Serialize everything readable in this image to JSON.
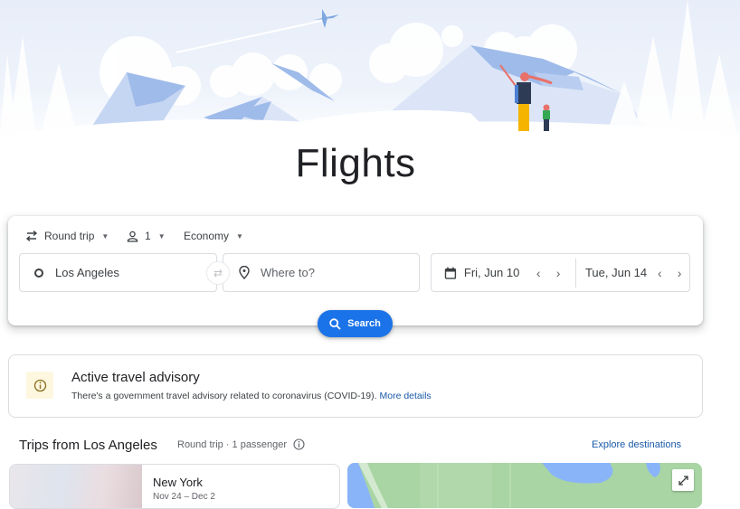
{
  "page": {
    "title": "Flights"
  },
  "search": {
    "trip_type": "Round trip",
    "passengers": "1",
    "cabin_class": "Economy",
    "origin": "Los Angeles",
    "destination_placeholder": "Where to?",
    "depart_date": "Fri, Jun 10",
    "return_date": "Tue, Jun 14",
    "search_label": "Search",
    "accent_color": "#1a73e8"
  },
  "advisory": {
    "title": "Active travel advisory",
    "text": "There's a government travel advisory related to coronavirus (COVID-19).",
    "link": "More details"
  },
  "trips": {
    "heading": "Trips from Los Angeles",
    "subtitle": "Round trip · 1 passenger",
    "explore_label": "Explore destinations",
    "items": [
      {
        "city": "New York",
        "dates": "Nov 24 – Dec 2"
      }
    ]
  }
}
